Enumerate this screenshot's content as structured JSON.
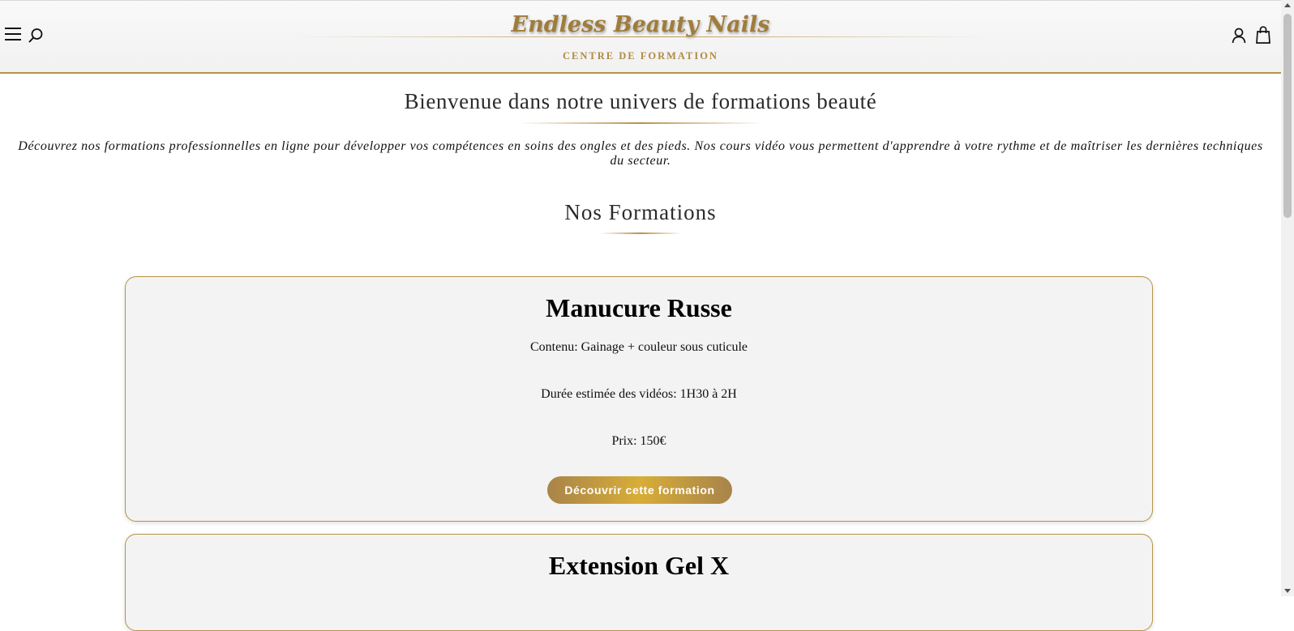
{
  "header": {
    "logo_title": "Endless Beauty Nails",
    "logo_subtitle": "CENTRE DE FORMATION",
    "icons": [
      "menu-icon",
      "search-icon",
      "account-icon",
      "shopping-bag-icon"
    ]
  },
  "welcome": {
    "title": "Bienvenue dans notre univers de formations beauté",
    "intro": "Découvrez nos formations professionnelles en ligne pour développer vos compétences en soins des ongles et des pieds. Nos cours vidéo vous permettent d'apprendre à votre rythme et de maîtriser les dernières techniques du secteur."
  },
  "formations": {
    "section_title": "Nos Formations",
    "items": [
      {
        "title": "Manucure Russe",
        "content": "Contenu: Gainage + couleur sous cuticule",
        "duration": "Durée estimée des vidéos: 1H30 à 2H",
        "price": "Prix: 150€",
        "cta": "Découvrir cette formation"
      },
      {
        "title": "Extension Gel X"
      }
    ]
  },
  "colors": {
    "accent_gold": "#b8924a",
    "button_gold_light": "#d8ad38",
    "card_background": "#f3f3f3"
  }
}
